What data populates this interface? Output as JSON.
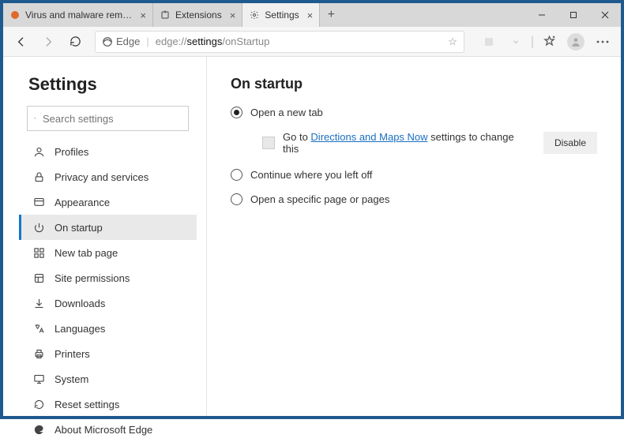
{
  "window": {
    "tabs": [
      {
        "title": "Virus and malware removal instr",
        "active": false
      },
      {
        "title": "Extensions",
        "active": false
      },
      {
        "title": "Settings",
        "active": true
      }
    ]
  },
  "toolbar": {
    "identity": "Edge",
    "url_muted_prefix": "edge://",
    "url_bold": "settings",
    "url_muted_suffix": "/onStartup"
  },
  "sidebar": {
    "title": "Settings",
    "search_placeholder": "Search settings",
    "items": [
      {
        "label": "Profiles"
      },
      {
        "label": "Privacy and services"
      },
      {
        "label": "Appearance"
      },
      {
        "label": "On startup"
      },
      {
        "label": "New tab page"
      },
      {
        "label": "Site permissions"
      },
      {
        "label": "Downloads"
      },
      {
        "label": "Languages"
      },
      {
        "label": "Printers"
      },
      {
        "label": "System"
      },
      {
        "label": "Reset settings"
      },
      {
        "label": "About Microsoft Edge"
      }
    ],
    "selected": "On startup"
  },
  "main": {
    "title": "On startup",
    "options": {
      "open_new_tab": "Open a new tab",
      "continue": "Continue where you left off",
      "specific": "Open a specific page or pages"
    },
    "extension_notice": {
      "prefix": "Go to ",
      "link": "Directions and Maps Now",
      "suffix": " settings to change this"
    },
    "disable_button": "Disable"
  }
}
